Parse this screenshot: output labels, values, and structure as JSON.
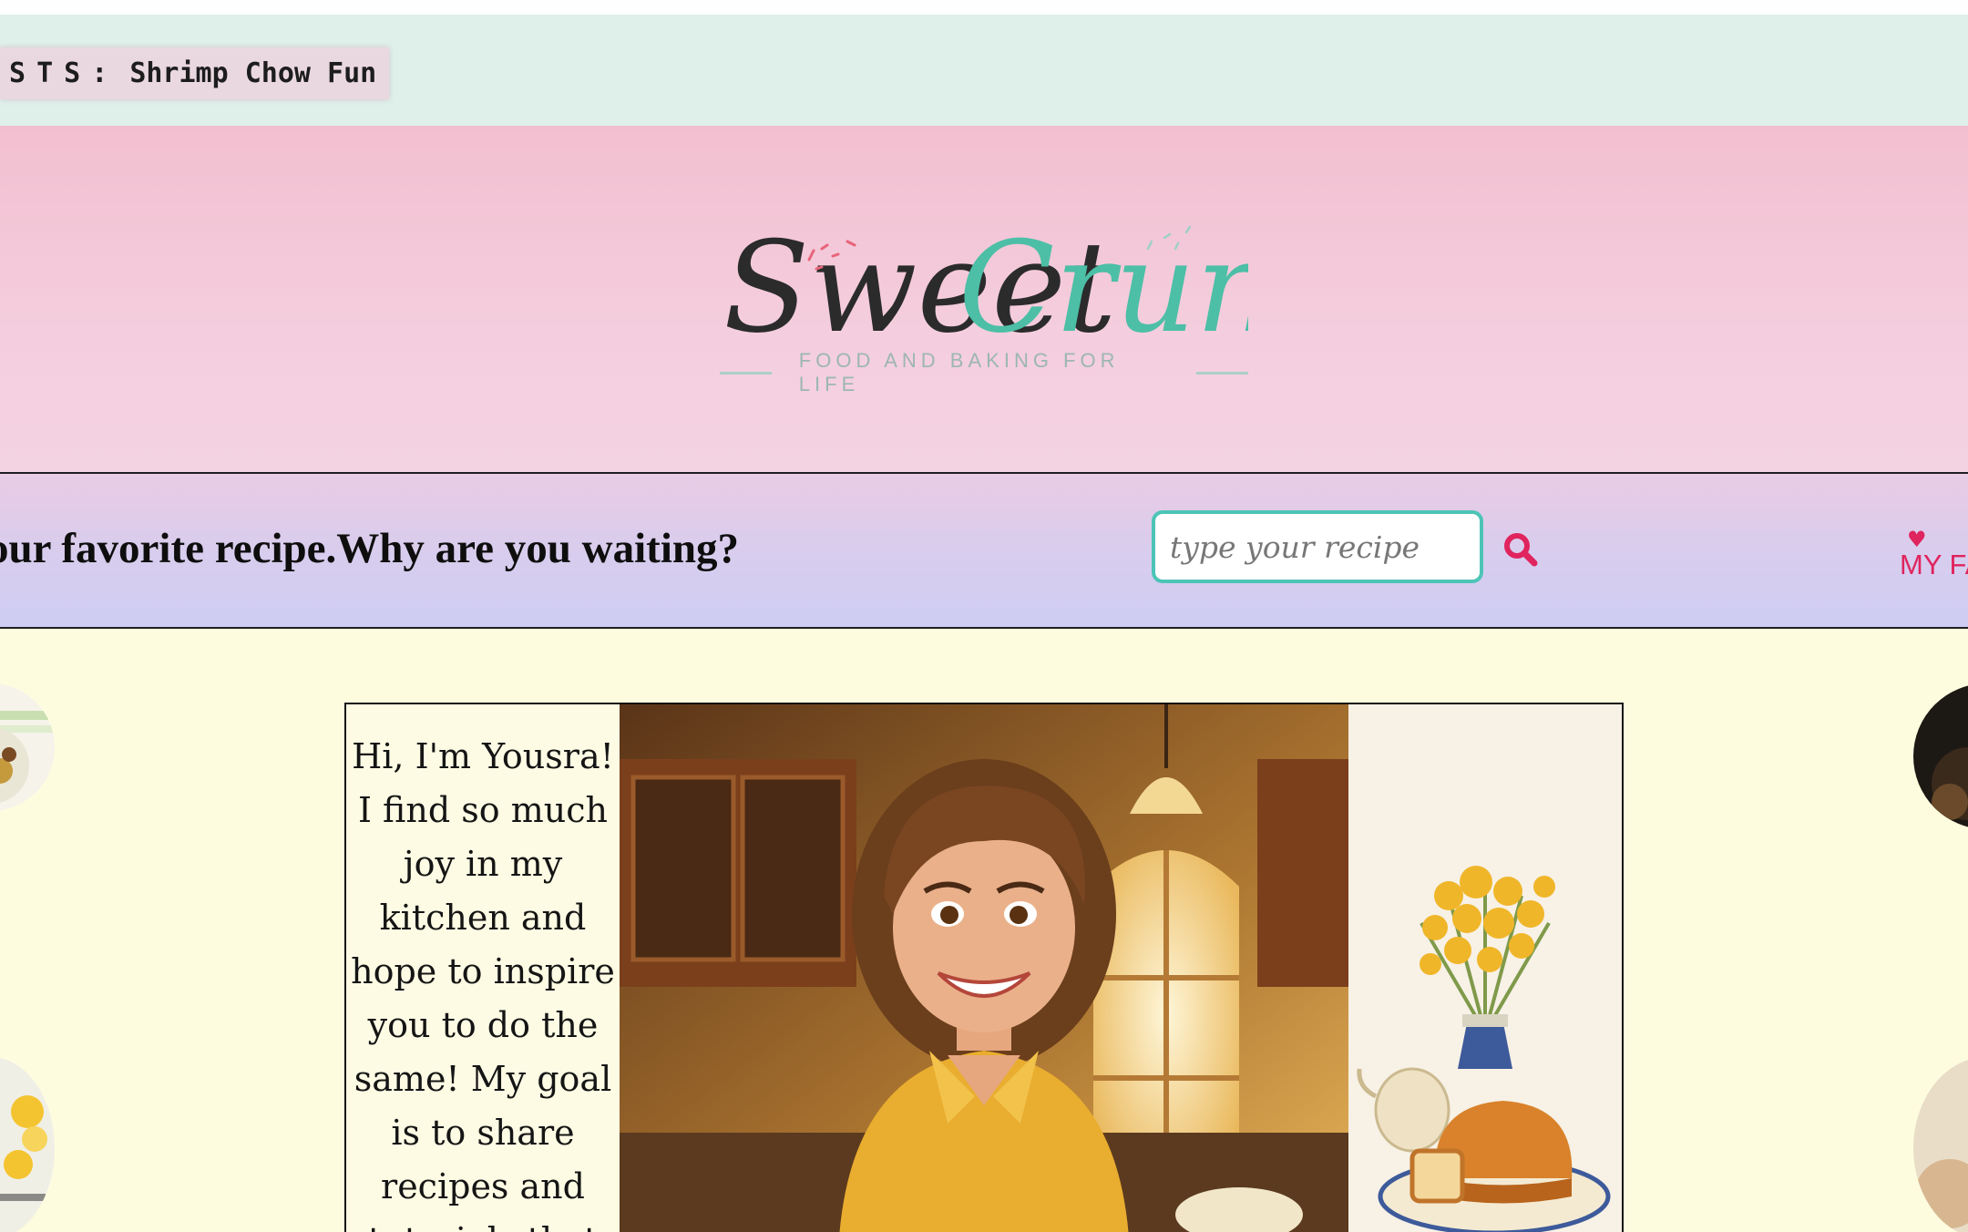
{
  "ticker": {
    "label": "OSTS:",
    "value": "Shrimp Chow Fun"
  },
  "logo": {
    "word1": "Sweet",
    "word2": "Crunch",
    "tagline": "FOOD AND BAKING FOR LIFE",
    "colors": {
      "word1": "#2b2b2b",
      "word2": "#4cbfa6",
      "sprinkles": "#e8647a"
    }
  },
  "searchbar": {
    "tagline": "our favorite recipe.Why are you waiting?",
    "placeholder": "type your recipe",
    "search_icon": "search-icon",
    "favorites_label": "MY FA",
    "favorites_icon": "heart-icon",
    "accent": "#e0245e",
    "input_border": "#4cc4b6"
  },
  "intro": {
    "text": "Hi, I'm Yousra! I find so much joy in my kitchen and hope to inspire you to do the same! My goal is to share recipes and tutorials that help you create dessert that"
  }
}
